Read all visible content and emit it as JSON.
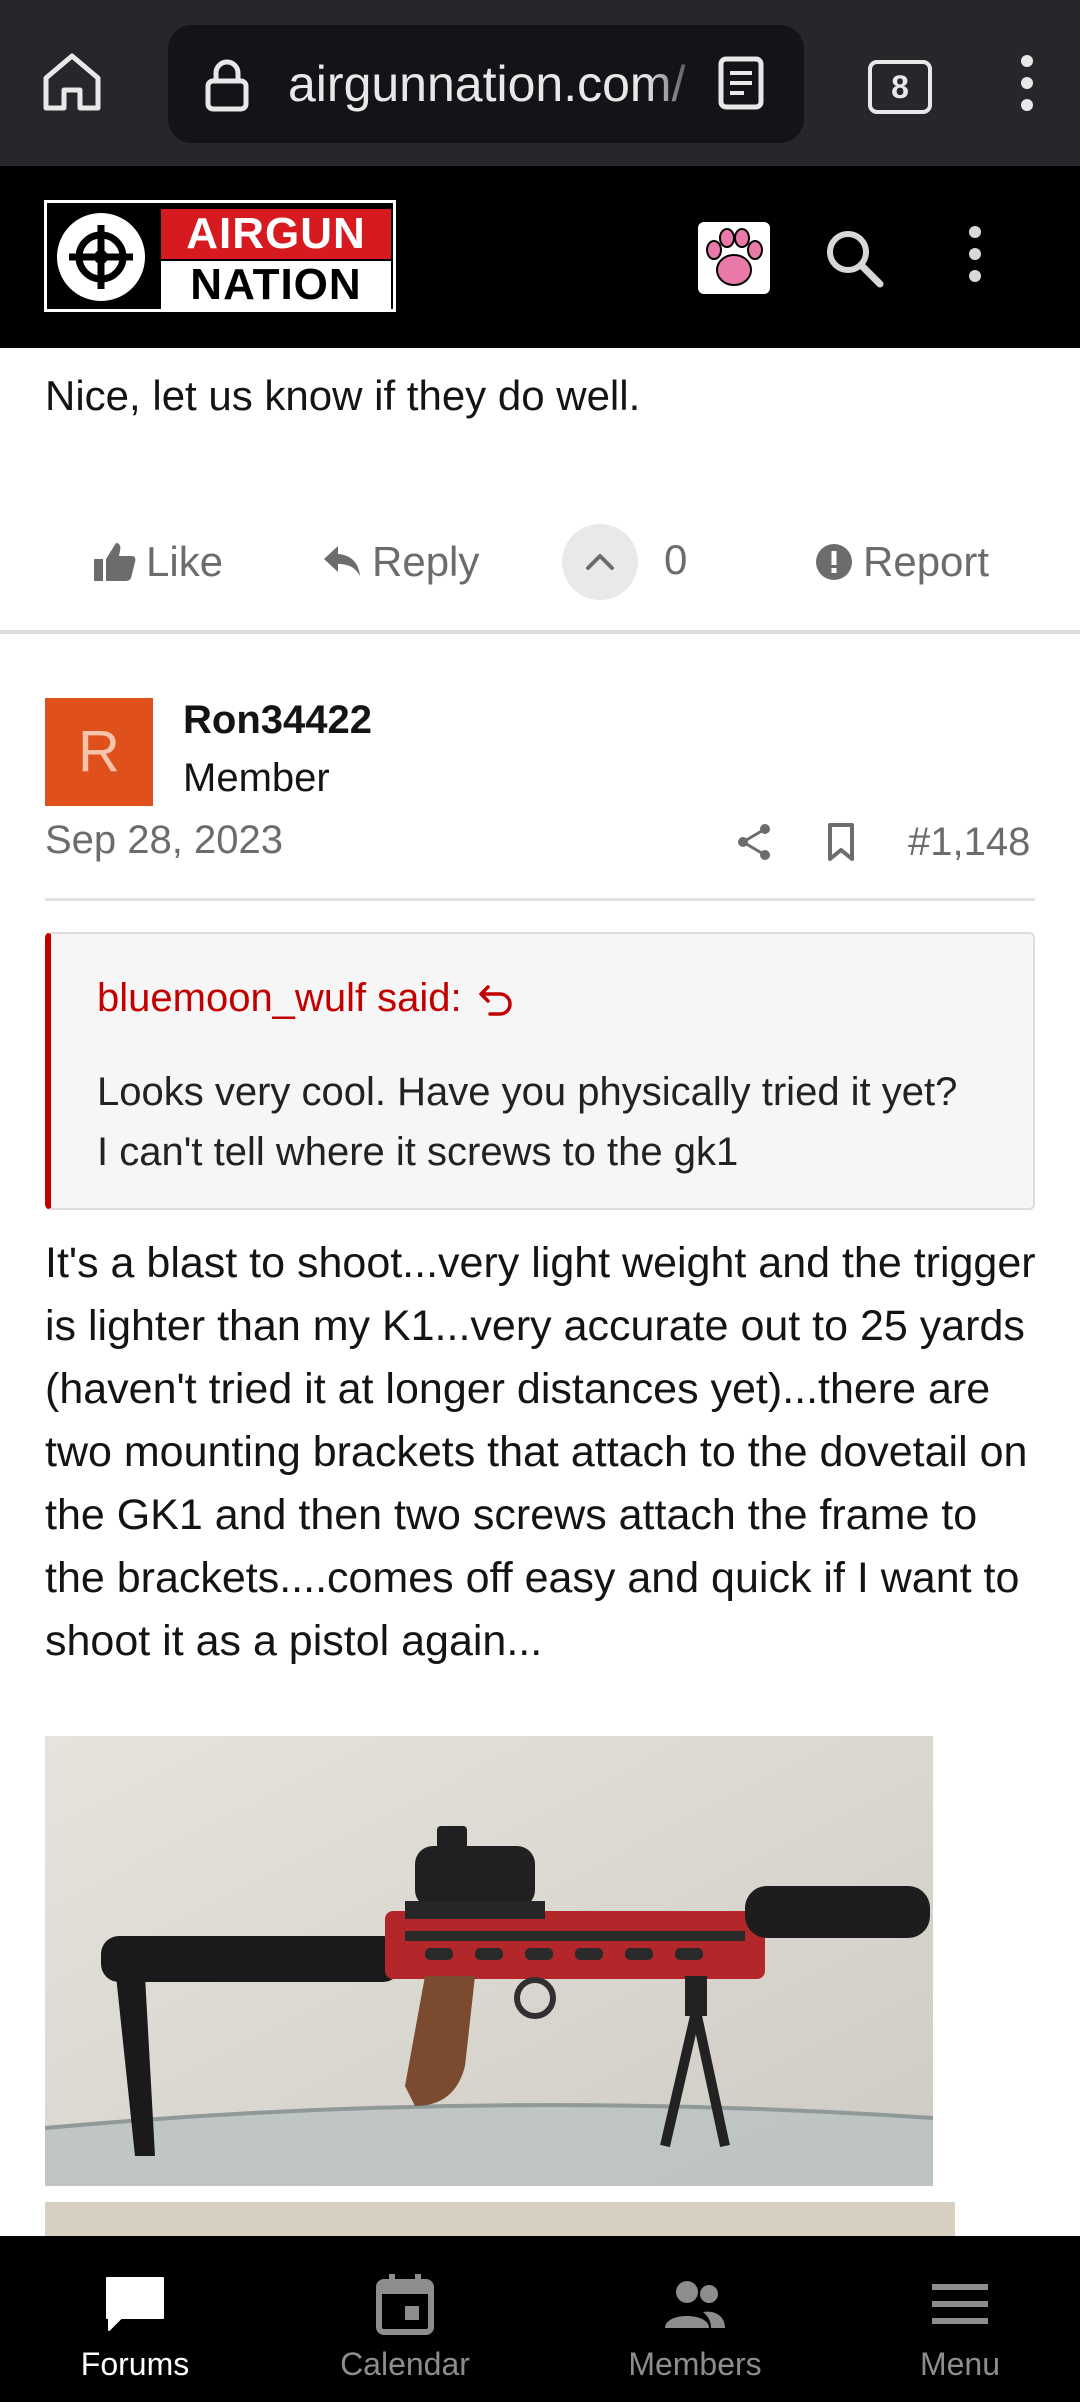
{
  "browser": {
    "url": "airgunnation.com/",
    "tab_count": "8"
  },
  "site": {
    "logo_line1": "AIRGUN",
    "logo_line2": "NATION"
  },
  "previous_post": {
    "text": "Nice, let us know if they do well.",
    "actions": {
      "like": "Like",
      "reply": "Reply",
      "vote_count": "0",
      "report": "Report"
    }
  },
  "post": {
    "avatar_letter": "R",
    "username": "Ron34422",
    "user_title": "Member",
    "date": "Sep 28, 2023",
    "post_number": "#1,148",
    "quote": {
      "author": "bluemoon_wulf said:",
      "text": "Looks very cool. Have you physically tried it yet? I can't tell where it screws to the gk1"
    },
    "body": "It's a blast to shoot...very light weight and the trigger is lighter than my K1...very accurate out to 25 yards (haven't tried it at longer distances yet)...there are two mounting brackets that attach to the dovetail on the GK1 and then two screws attach the frame to the brackets....comes off easy and quick if I want to shoot it as a pistol again..."
  },
  "bottom_nav": [
    {
      "label": "Forums",
      "icon": "chat-bubble-icon",
      "active": true
    },
    {
      "label": "Calendar",
      "icon": "calendar-icon",
      "active": false
    },
    {
      "label": "Members",
      "icon": "members-icon",
      "active": false
    },
    {
      "label": "Menu",
      "icon": "hamburger-menu-icon",
      "active": false
    }
  ],
  "colors": {
    "brand_red": "#d71920",
    "quote_red": "#c20000",
    "avatar_orange": "#e0501c"
  }
}
